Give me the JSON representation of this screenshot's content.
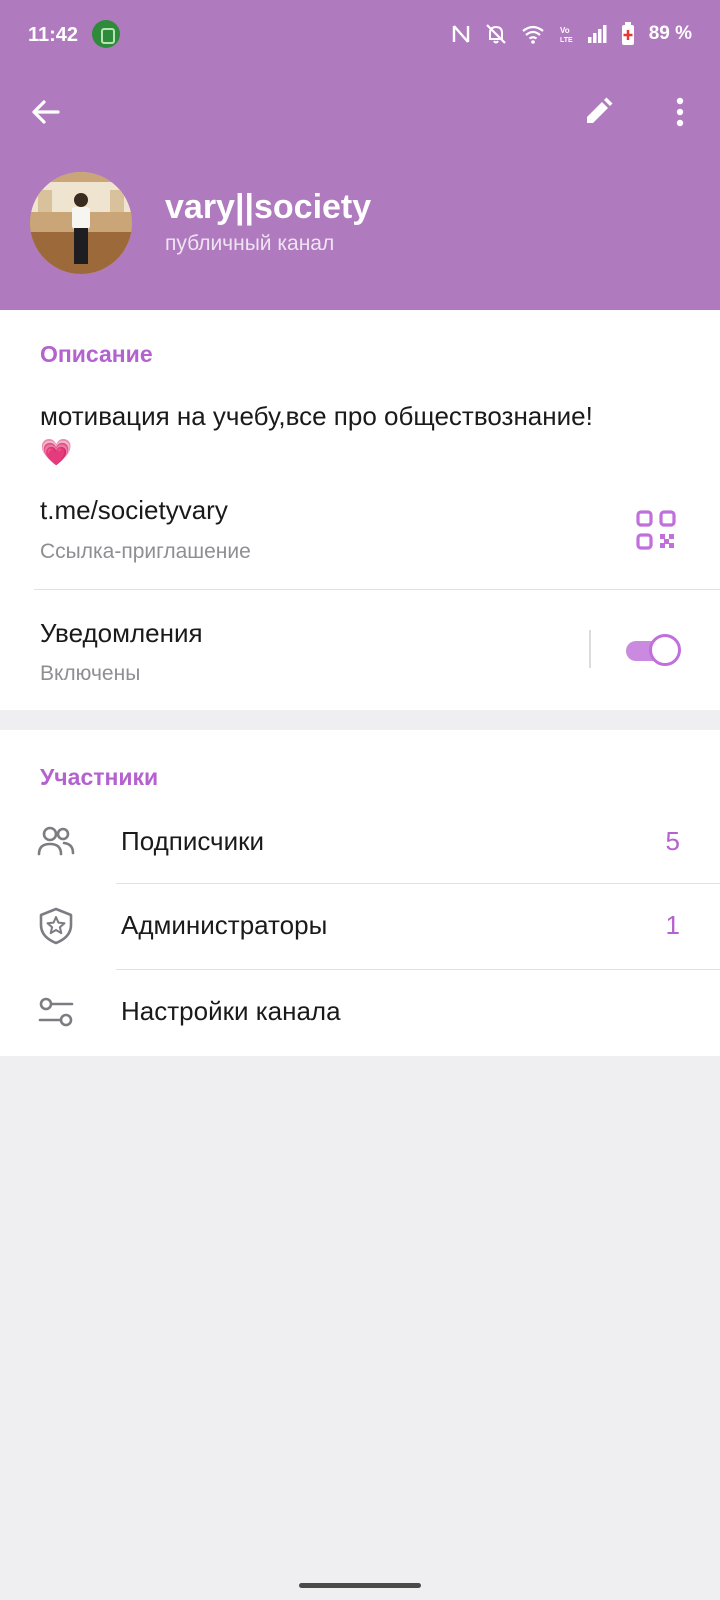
{
  "status_bar": {
    "time": "11:42",
    "battery": "89 %"
  },
  "colors": {
    "header": "#b07abf",
    "accent": "#b362cf",
    "toggle": "#c98ae0"
  },
  "toolbar": {
    "back_icon": "arrow-left-icon",
    "edit_icon": "pencil-icon",
    "more_icon": "dots-vertical-icon"
  },
  "channel": {
    "name": "vary||society",
    "type": "публичный канал"
  },
  "description": {
    "title": "Описание",
    "text": "мотивация на учебу,все про обществознание!",
    "emoji": "💗"
  },
  "invite_link": {
    "url": "t.me/societyvary",
    "label": "Ссылка-приглашение"
  },
  "notifications": {
    "title": "Уведомления",
    "status": "Включены",
    "enabled": true
  },
  "members": {
    "title": "Участники",
    "items": [
      {
        "label": "Подписчики",
        "count": "5",
        "icon": "users-icon"
      },
      {
        "label": "Администраторы",
        "count": "1",
        "icon": "shield-star-icon"
      },
      {
        "label": "Настройки канала",
        "count": "",
        "icon": "sliders-icon"
      }
    ]
  }
}
